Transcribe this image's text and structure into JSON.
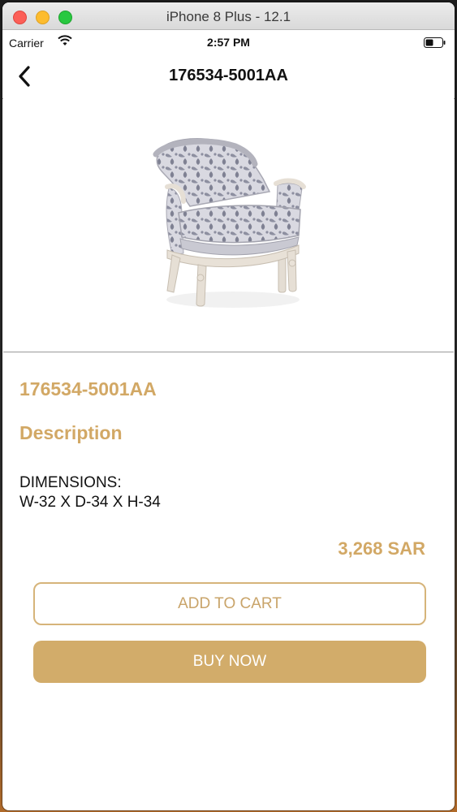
{
  "window": {
    "title": "iPhone 8 Plus - 12.1"
  },
  "status_bar": {
    "carrier": "Carrier",
    "time": "2:57 PM"
  },
  "nav": {
    "title": "176534-5001AA",
    "back_icon": "chevron-left-icon"
  },
  "product": {
    "code": "176534-5001AA",
    "description_heading": "Description",
    "dimensions_label": "DIMENSIONS:",
    "dimensions_value": "W-32 X D-34 X H-34",
    "price": "3,268 SAR",
    "image": "armchair-photo"
  },
  "actions": {
    "add_to_cart": "ADD TO CART",
    "buy_now": "BUY NOW"
  },
  "colors": {
    "accent": "#d2a865",
    "button_fill": "#d2ac6a"
  }
}
